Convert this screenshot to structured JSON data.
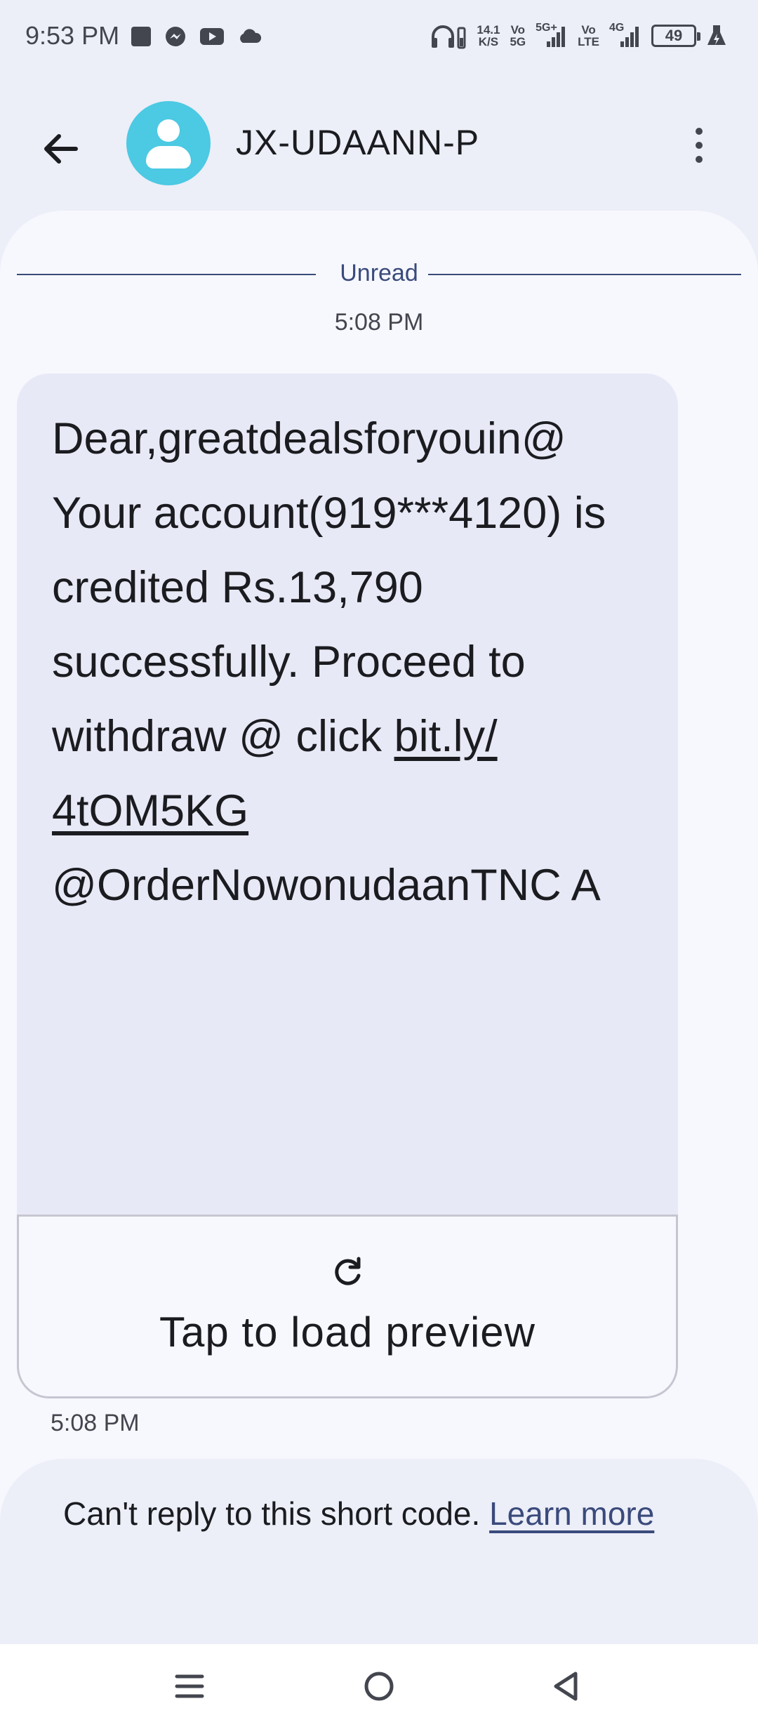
{
  "status_bar": {
    "time": "9:53 PM",
    "net_speed_top": "14.1",
    "net_speed_bottom": "K/S",
    "sim1_top": "Vo",
    "sim1_bottom": "5G",
    "sim1_type": "5G+",
    "sim2_top": "Vo",
    "sim2_bottom": "LTE",
    "sim2_type": "4G",
    "battery": "49"
  },
  "app_bar": {
    "title": "JX-UDAANN-P"
  },
  "conversation": {
    "unread_label": "Unread",
    "date_time": "5:08 PM",
    "message_before_link": "Dear,greatdealsforyouin@ Your account(919***4120) is credited Rs.13,790 successfully. Proceed to withdraw @ click ",
    "message_link": "bit.ly/ 4tOM5KG",
    "message_after_link": " @OrderNowonudaanTNC A",
    "preview_label": "Tap to load preview",
    "message_time": "5:08 PM"
  },
  "notice": {
    "text": "Can't reply to this short code. ",
    "learn_more": "Learn more"
  },
  "colors": {
    "accent": "#3a4a7b",
    "avatar": "#4cc9e3",
    "bubble": "#e8e9f6"
  }
}
